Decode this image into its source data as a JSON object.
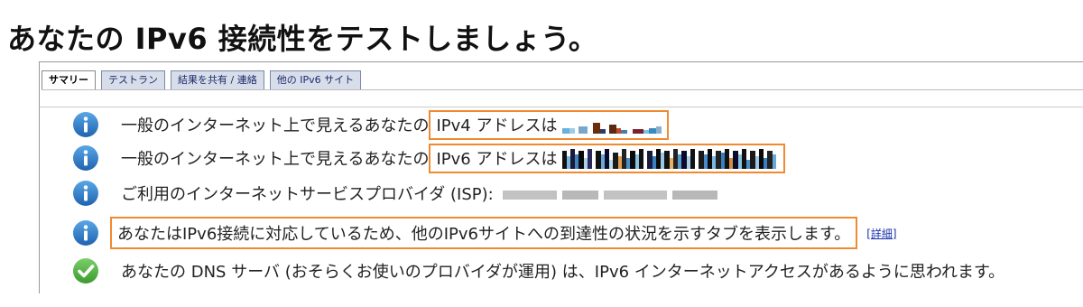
{
  "page": {
    "title": "あなたの IPv6 接続性をテストしましょう。"
  },
  "tabs": [
    {
      "label": "サマリー",
      "active": true
    },
    {
      "label": "テストラン",
      "active": false
    },
    {
      "label": "結果を共有 / 連絡",
      "active": false
    },
    {
      "label": "他の IPv6 サイト",
      "active": false
    }
  ],
  "rows": [
    {
      "icon": "info-icon",
      "prefix": "一般のインターネット上で見えるあなたの",
      "highlight": "IPv4 アドレスは"
    },
    {
      "icon": "info-icon",
      "prefix": "一般のインターネット上で見えるあなたの",
      "highlight": "IPv6 アドレスは"
    },
    {
      "icon": "info-icon",
      "text": "ご利用のインターネットサービスプロバイダ (ISP):"
    },
    {
      "icon": "info-icon",
      "highlight": "あなたはIPv6接続に対応しているため、他のIPv6サイトへの到達性の状況を示すタブを表示します。",
      "link": "[詳細]"
    },
    {
      "icon": "check-icon",
      "text": "あなたの DNS サーバ (おそらくお使いのプロバイダが運用) は、IPv6 インターネットアクセスがあるように思われます。"
    }
  ],
  "colors": {
    "info": "#2e7ac9",
    "check": "#58b84a",
    "highlight_border": "#f08a30",
    "tab_bg": "#d8ddea"
  }
}
